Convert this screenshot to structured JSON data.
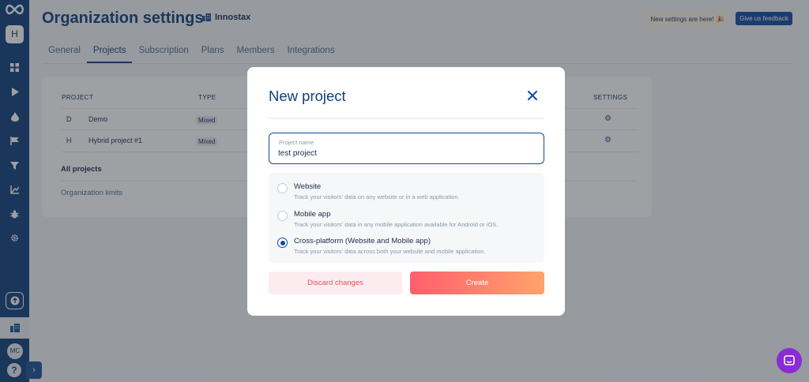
{
  "header": {
    "title": "Organization settings",
    "org_name": "Innostax",
    "notice": "New settings are here!",
    "notice_emoji": "🎉",
    "feedback_label": "Give us feedback"
  },
  "tabs": [
    {
      "label": "General"
    },
    {
      "label": "Projects"
    },
    {
      "label": "Subscription"
    },
    {
      "label": "Plans"
    },
    {
      "label": "Members"
    },
    {
      "label": "Integrations"
    }
  ],
  "sidebar": {
    "workspace_initial": "H",
    "user_initials": "MC",
    "help_label": "?",
    "icons": [
      "dashboard-icon",
      "play-icon",
      "drop-icon",
      "flag-icon",
      "funnel-icon",
      "chart-icon",
      "bug-icon",
      "gear-icon"
    ]
  },
  "table": {
    "headers": {
      "project": "PROJECT",
      "type": "TYPE",
      "settings": "SETTINGS"
    },
    "rows": [
      {
        "initial": "D",
        "name": "Demo",
        "type": "Mixed"
      },
      {
        "initial": "H",
        "name": "Hybrid project #1",
        "type": "Mixed"
      }
    ],
    "all_projects": "All projects",
    "organization_limits": "Organization limits"
  },
  "modal": {
    "title": "New project",
    "field_label": "Project name",
    "field_value": "test project",
    "options": [
      {
        "title": "Website",
        "desc": "Track your visitors' data on any website or in a web application.",
        "checked": false
      },
      {
        "title": "Mobile app",
        "desc": "Track your visitors' data in any mobile application available for Android or iOS.",
        "checked": false
      },
      {
        "title": "Cross-platform (Website and Mobile app)",
        "desc": "Track your visitors' data across both your website and mobile application.",
        "checked": true
      }
    ],
    "discard_label": "Discard changes",
    "create_label": "Create"
  },
  "colors": {
    "brand": "#0f3f7a",
    "primary": "#0f4aa0",
    "danger": "#e8505b",
    "chat": "#8a2bd6"
  }
}
